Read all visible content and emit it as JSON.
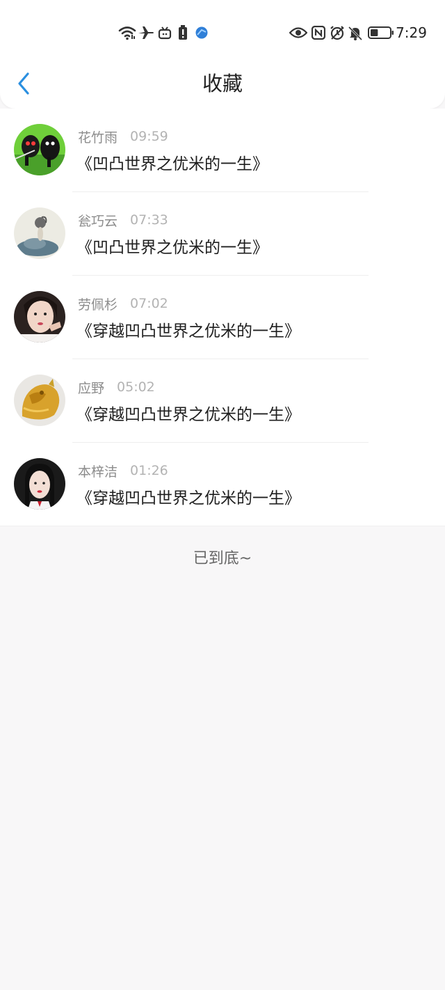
{
  "status_bar": {
    "time": "7:29",
    "icons": [
      "wifi-icon",
      "airplane-icon",
      "tv-icon",
      "battery-alert-icon",
      "browser-icon",
      "eye-icon",
      "nfc-icon",
      "alarm-icon",
      "bell-off-icon",
      "battery-icon"
    ],
    "battery_percent": 40
  },
  "header": {
    "title": "收藏",
    "back_icon": "chevron-left-icon"
  },
  "favorites": [
    {
      "user": "花竹雨",
      "time": "09:59",
      "book": "《凹凸世界之优米的一生》"
    },
    {
      "user": "瓮巧云",
      "time": "07:33",
      "book": "《凹凸世界之优米的一生》"
    },
    {
      "user": "劳佩杉",
      "time": "07:02",
      "book": "《穿越凹凸世界之优米的一生》"
    },
    {
      "user": "应野",
      "time": "05:02",
      "book": "《穿越凹凸世界之优米的一生》"
    },
    {
      "user": "本梓洁",
      "time": "01:26",
      "book": "《穿越凹凸世界之优米的一生》"
    }
  ],
  "footer": {
    "end_text": "已到底~"
  },
  "colors": {
    "accent": "#2a8fe0",
    "background": "#f8f7f8",
    "surface": "#ffffff"
  }
}
